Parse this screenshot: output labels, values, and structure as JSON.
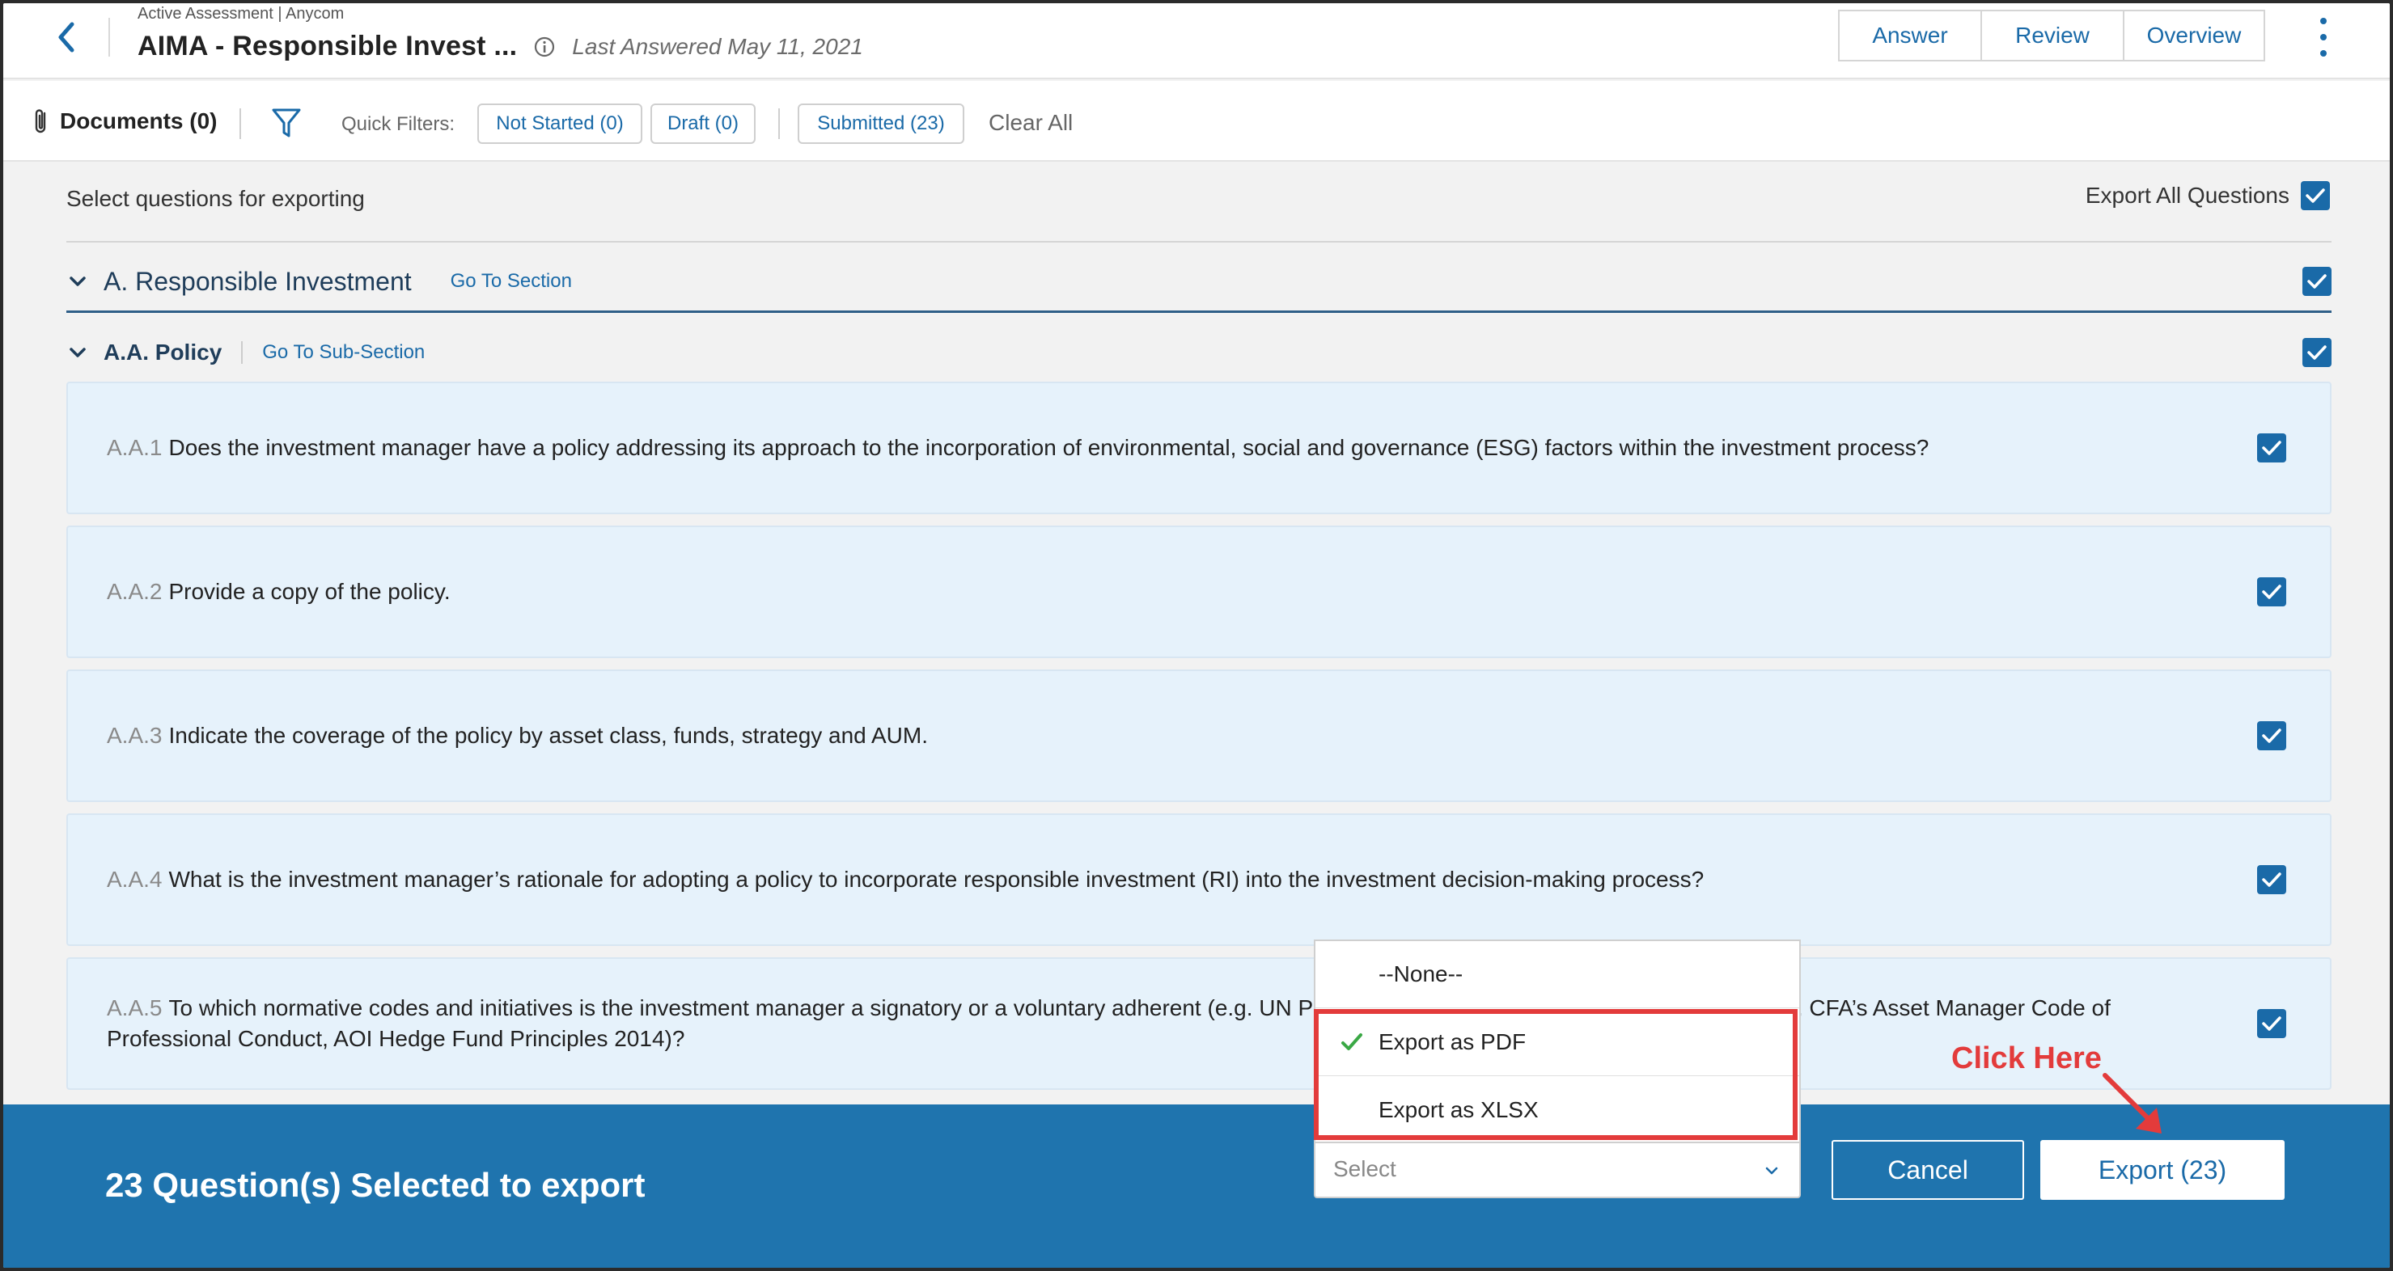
{
  "header": {
    "breadcrumb": "Active Assessment | Anycom",
    "title": "AIMA - Responsible Invest ...",
    "last_answered": "Last Answered May 11, 2021",
    "tabs": [
      "Answer",
      "Review",
      "Overview"
    ]
  },
  "filterbar": {
    "documents": "Documents (0)",
    "quick_filters_label": "Quick Filters:",
    "not_started": "Not Started (0)",
    "draft": "Draft (0)",
    "submitted": "Submitted (23)",
    "clear_all": "Clear All"
  },
  "content": {
    "select_label": "Select questions for exporting",
    "export_all_label": "Export All Questions",
    "section": {
      "title": "A. Responsible Investment",
      "goto": "Go To Section"
    },
    "subsection": {
      "title": "A.A. Policy",
      "goto": "Go To Sub-Section"
    },
    "questions": [
      {
        "num": "A.A.1",
        "text": "Does the investment manager have a policy addressing its approach to the incorporation of environmental, social and governance (ESG) factors within the investment process?"
      },
      {
        "num": "A.A.2",
        "text": "Provide a copy of the policy."
      },
      {
        "num": "A.A.3",
        "text": "Indicate the coverage of the policy by asset class, funds, strategy and AUM."
      },
      {
        "num": "A.A.4",
        "text": "What is the investment manager’s rationale for adopting a policy to incorporate responsible investment (RI) into the investment decision-making process?"
      },
      {
        "num": "A.A.5",
        "text": "To which normative codes and initiatives is the investment manager a signatory or a voluntary adherent (e.g. UN PRI, UN Global Compact, Hedge Fund Standards, CFA’s Asset Manager Code of Professional Conduct, AOI Hedge Fund Principles 2014)?"
      }
    ]
  },
  "footer": {
    "selected_label": "23 Question(s) Selected to export",
    "select_placeholder": "Select",
    "cancel": "Cancel",
    "export": "Export (23)"
  },
  "dropdown": {
    "options": [
      "--None--",
      "Export as PDF",
      "Export as XLSX"
    ],
    "selected": "Export as PDF"
  },
  "annotation": {
    "click_here": "Click Here"
  },
  "colors": {
    "accent": "#1a6aa8",
    "footer": "#1f74ae",
    "card": "#e6f2fb",
    "highlight": "#e33b3b",
    "check": "#3aa845"
  }
}
